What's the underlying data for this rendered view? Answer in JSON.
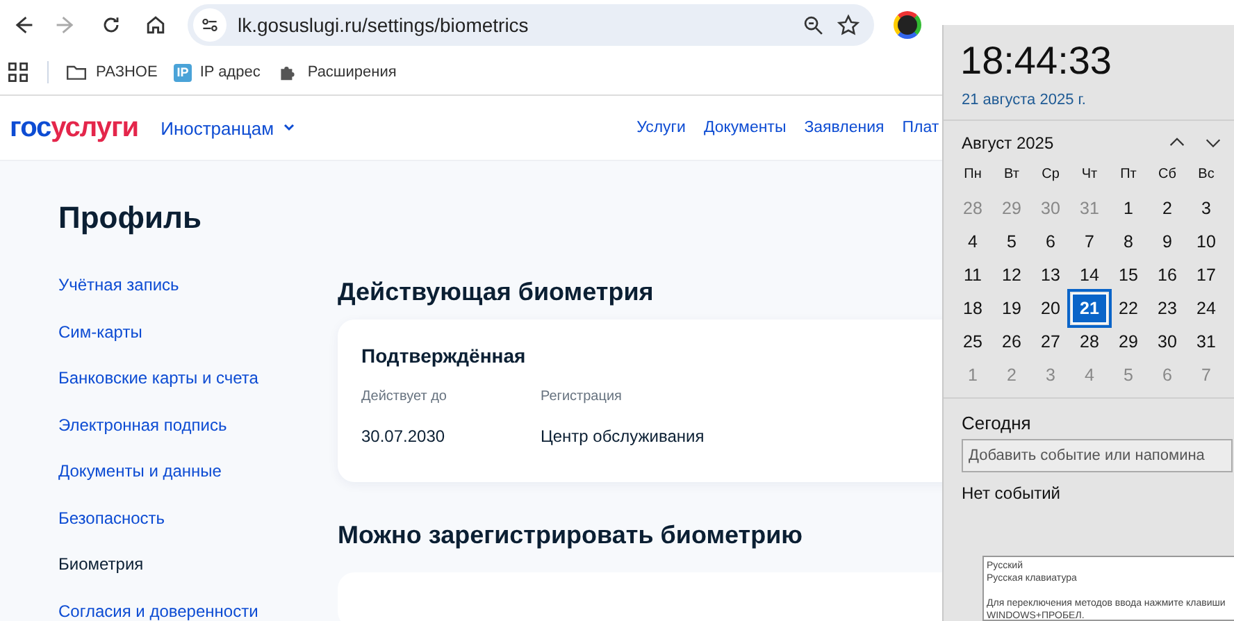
{
  "browser": {
    "url": "lk.gosuslugi.ru/settings/biometrics",
    "bookmarks": [
      {
        "kind": "folder",
        "label": "РАЗНОЕ"
      },
      {
        "kind": "ip",
        "icon_text": "IP",
        "label": "IP адрес"
      },
      {
        "kind": "puzzle",
        "label": "Расширения"
      }
    ]
  },
  "site_header": {
    "logo_a": "гос",
    "logo_b": "услуги",
    "menu": "Иностранцам",
    "nav": [
      "Услуги",
      "Документы",
      "Заявления",
      "Плат"
    ]
  },
  "profile": {
    "title": "Профиль",
    "sidebar": [
      {
        "label": "Учётная запись",
        "selected": false
      },
      {
        "label": "Сим-карты",
        "selected": false
      },
      {
        "label": "Банковские карты и счета",
        "selected": false
      },
      {
        "label": "Электронная подпись",
        "selected": false
      },
      {
        "label": "Документы и данные",
        "selected": false
      },
      {
        "label": "Безопасность",
        "selected": false
      },
      {
        "label": "Биометрия",
        "selected": true
      },
      {
        "label": "Согласия и доверенности",
        "selected": false
      }
    ],
    "current_heading": "Действующая биометрия",
    "card": {
      "title": "Подтверждённая",
      "fields": [
        {
          "label": "Действует до",
          "value": "30.07.2030"
        },
        {
          "label": "Регистрация",
          "value": "Центр обслуживания"
        }
      ]
    },
    "register_heading": "Можно зарегистрировать биометрию"
  },
  "clock": {
    "time": "18:44:33",
    "date": "21 августа 2025 г.",
    "month": "Август 2025",
    "weekdays": [
      "Пн",
      "Вт",
      "Ср",
      "Чт",
      "Пт",
      "Сб",
      "Вс"
    ],
    "weeks": [
      [
        {
          "day": "28",
          "other_month": true,
          "selected": false
        },
        {
          "day": "29",
          "other_month": true,
          "selected": false
        },
        {
          "day": "30",
          "other_month": true,
          "selected": false
        },
        {
          "day": "31",
          "other_month": true,
          "selected": false
        },
        {
          "day": "1",
          "other_month": false,
          "selected": false
        },
        {
          "day": "2",
          "other_month": false,
          "selected": false
        },
        {
          "day": "3",
          "other_month": false,
          "selected": false
        }
      ],
      [
        {
          "day": "4",
          "other_month": false,
          "selected": false
        },
        {
          "day": "5",
          "other_month": false,
          "selected": false
        },
        {
          "day": "6",
          "other_month": false,
          "selected": false
        },
        {
          "day": "7",
          "other_month": false,
          "selected": false
        },
        {
          "day": "8",
          "other_month": false,
          "selected": false
        },
        {
          "day": "9",
          "other_month": false,
          "selected": false
        },
        {
          "day": "10",
          "other_month": false,
          "selected": false
        }
      ],
      [
        {
          "day": "11",
          "other_month": false,
          "selected": false
        },
        {
          "day": "12",
          "other_month": false,
          "selected": false
        },
        {
          "day": "13",
          "other_month": false,
          "selected": false
        },
        {
          "day": "14",
          "other_month": false,
          "selected": false
        },
        {
          "day": "15",
          "other_month": false,
          "selected": false
        },
        {
          "day": "16",
          "other_month": false,
          "selected": false
        },
        {
          "day": "17",
          "other_month": false,
          "selected": false
        }
      ],
      [
        {
          "day": "18",
          "other_month": false,
          "selected": false
        },
        {
          "day": "19",
          "other_month": false,
          "selected": false
        },
        {
          "day": "20",
          "other_month": false,
          "selected": false
        },
        {
          "day": "21",
          "other_month": false,
          "selected": true
        },
        {
          "day": "22",
          "other_month": false,
          "selected": false
        },
        {
          "day": "23",
          "other_month": false,
          "selected": false
        },
        {
          "day": "24",
          "other_month": false,
          "selected": false
        }
      ],
      [
        {
          "day": "25",
          "other_month": false,
          "selected": false
        },
        {
          "day": "26",
          "other_month": false,
          "selected": false
        },
        {
          "day": "27",
          "other_month": false,
          "selected": false
        },
        {
          "day": "28",
          "other_month": false,
          "selected": false
        },
        {
          "day": "29",
          "other_month": false,
          "selected": false
        },
        {
          "day": "30",
          "other_month": false,
          "selected": false
        },
        {
          "day": "31",
          "other_month": false,
          "selected": false
        }
      ],
      [
        {
          "day": "1",
          "other_month": true,
          "selected": false
        },
        {
          "day": "2",
          "other_month": true,
          "selected": false
        },
        {
          "day": "3",
          "other_month": true,
          "selected": false
        },
        {
          "day": "4",
          "other_month": true,
          "selected": false
        },
        {
          "day": "5",
          "other_month": true,
          "selected": false
        },
        {
          "day": "6",
          "other_month": true,
          "selected": false
        },
        {
          "day": "7",
          "other_month": true,
          "selected": false
        }
      ]
    ],
    "today_label": "Сегодня",
    "event_placeholder": "Добавить событие или напомина",
    "no_events": "Нет событий"
  },
  "ime_tooltip": {
    "language": "Русский",
    "layout": "Русская клавиатура",
    "hint": "Для переключения методов ввода нажмите клавиши WINDOWS+ПРОБЕЛ."
  }
}
